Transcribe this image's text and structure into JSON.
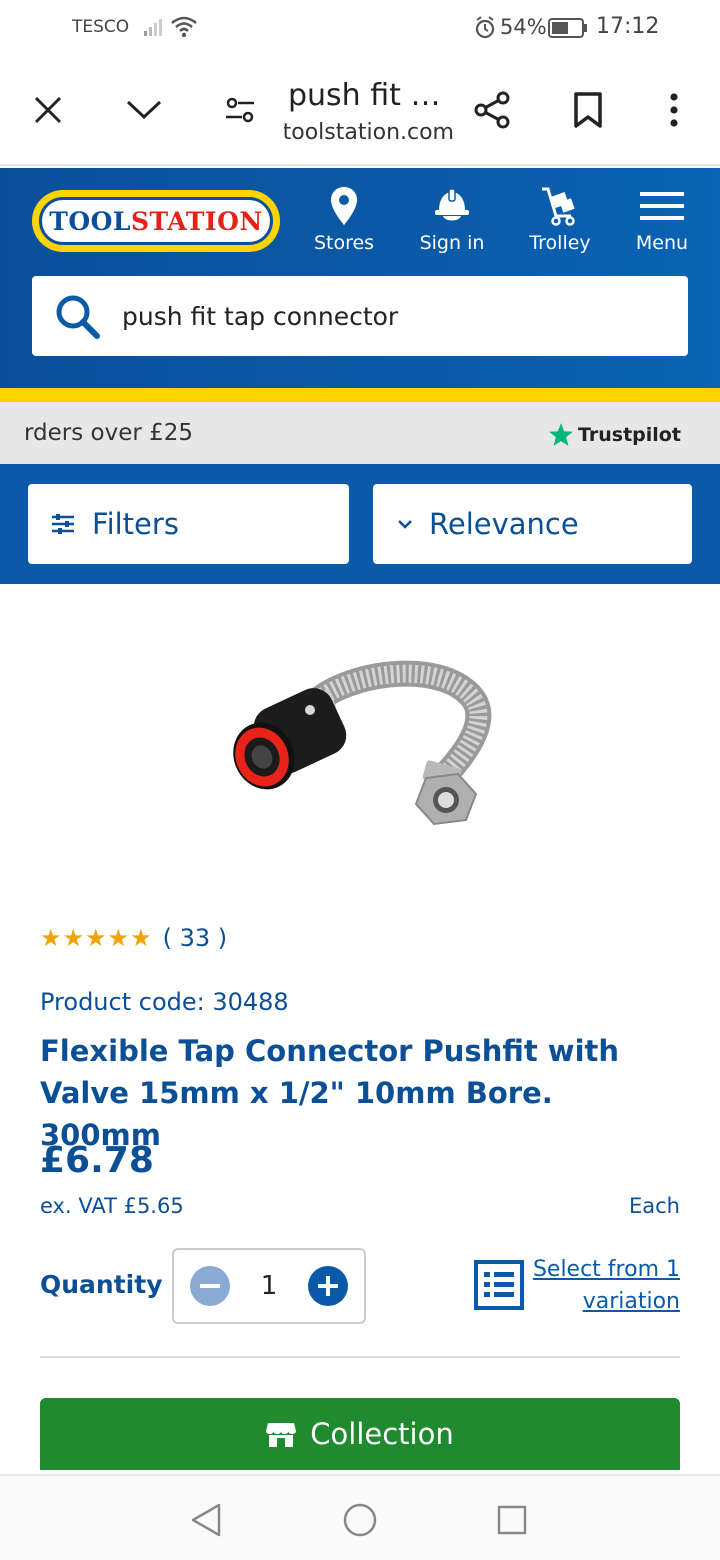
{
  "status_bar": {
    "carrier": "TESCO",
    "battery_percent": "54%",
    "time": "17:12",
    "icons": [
      "signal-icon",
      "wifi-icon",
      "alarm-icon",
      "battery-icon"
    ]
  },
  "browser": {
    "page_title": "push fit t...",
    "url": "toolstation.com",
    "icons": [
      "close-icon",
      "chevron-down-icon",
      "tune-icon",
      "share-icon",
      "bookmark-icon",
      "more-icon"
    ]
  },
  "header": {
    "logo_part1": "TOOL",
    "logo_part2": "STATION",
    "nav": [
      {
        "label": "Stores",
        "icon": "location-pin-icon"
      },
      {
        "label": "Sign in",
        "icon": "hard-hat-icon"
      },
      {
        "label": "Trolley",
        "icon": "trolley-icon"
      },
      {
        "label": "Menu",
        "icon": "hamburger-icon"
      }
    ],
    "search_value": "push fit tap connector",
    "colors": {
      "brand_blue": "#0b5aa8",
      "brand_yellow": "#ffd400",
      "brand_red": "#e2231a"
    }
  },
  "promo": {
    "text": "rders over £25",
    "trustpilot": "Trustpilot"
  },
  "filters": {
    "filter_label": "Filters",
    "sort_label": "Relevance"
  },
  "product": {
    "rating": 5,
    "stars": "★★★★★",
    "review_count": "( 33 )",
    "code": "Product code: 30488",
    "name": "Flexible Tap Connector Pushfit with Valve 15mm x 1/2\" 10mm Bore. 300mm",
    "price": "£6.78",
    "ex_vat": "ex. VAT £5.65",
    "unit": "Each",
    "quantity_label": "Quantity",
    "quantity": "1",
    "variation_line1": "Select from 1",
    "variation_line2": "variation",
    "collection_label": "Collection",
    "colors": {
      "text_blue": "#0b4f96",
      "collection_green": "#1f8a2e",
      "star_gold": "#f0a30a"
    }
  },
  "android_nav": {
    "icons": [
      "back-icon",
      "home-icon",
      "recents-icon"
    ]
  }
}
